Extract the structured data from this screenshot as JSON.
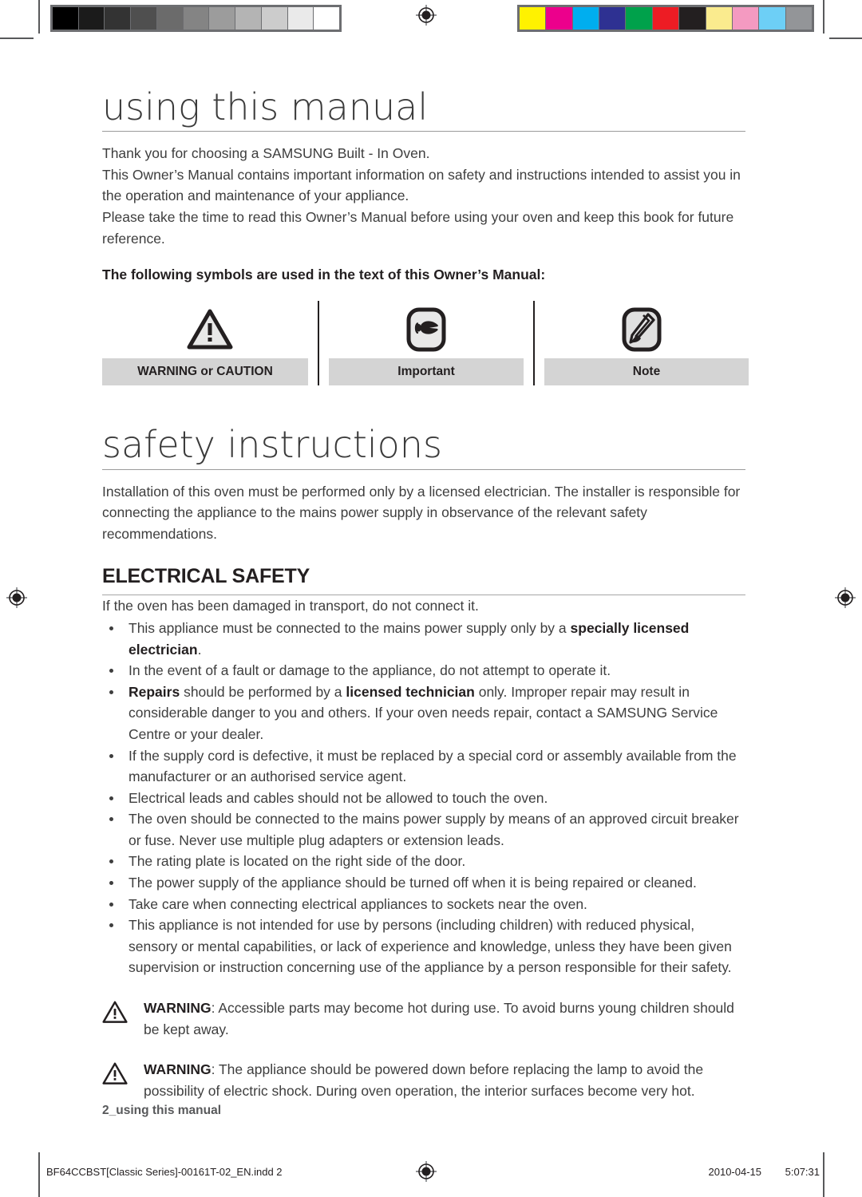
{
  "page": {
    "running_footer": "2_using this manual",
    "print_footer": {
      "file": "BF64CCBST[Classic Series]-00161T-02_EN.indd   2",
      "date": "2010-04-15",
      "time": "5:07:31"
    }
  },
  "calibration": {
    "gray_bar_label": "grayscale-calibration-bar",
    "gray_swatches": [
      "#000000",
      "#1b1b1b",
      "#333333",
      "#4f4f4f",
      "#6b6b6b",
      "#848484",
      "#9c9c9c",
      "#b4b4b4",
      "#cccccc",
      "#eaeaea",
      "#ffffff"
    ],
    "color_bar_label": "color-calibration-bar",
    "color_swatches": [
      "#fff200",
      "#ec008c",
      "#00aeef",
      "#2e3192",
      "#00a14b",
      "#ed1c24",
      "#231f20",
      "#faeb8e",
      "#f49ac1",
      "#6dcff6",
      "#939598"
    ]
  },
  "chapter1": {
    "title": "using this manual",
    "paragraphs": [
      "Thank you for choosing a SAMSUNG Built - In Oven.",
      "This Owner’s Manual contains important information on safety and instructions intended to assist you in the operation and maintenance of your appliance.",
      "Please take the time to read this Owner’s Manual before using your oven and keep this book for future reference."
    ],
    "symbols_lead_in": "The following symbols are used in the text of this Owner’s Manual:",
    "symbols": [
      {
        "icon": "warning-triangle-icon",
        "label": "WARNING or CAUTION"
      },
      {
        "icon": "pointing-hand-icon",
        "label": "Important"
      },
      {
        "icon": "pencil-note-icon",
        "label": "Note"
      }
    ]
  },
  "chapter2": {
    "title": "safety instructions",
    "intro": "Installation of this oven must be performed only by a licensed electrician. The installer is responsible for connecting the appliance to the mains power supply in observance of the relevant safety recommendations.",
    "section": {
      "heading": "ELECTRICAL SAFETY",
      "intro": "If the oven has been damaged in transport, do not connect it.",
      "bullets": [
        [
          {
            "t": "This appliance must be connected to the mains power supply only by a "
          },
          {
            "t": "specially licensed electrician",
            "b": true
          },
          {
            "t": "."
          }
        ],
        [
          {
            "t": "In the event of a fault or damage to the appliance, do not attempt to operate it."
          }
        ],
        [
          {
            "t": "Repairs",
            "b": true
          },
          {
            "t": " should be performed by a "
          },
          {
            "t": "licensed technician",
            "b": true
          },
          {
            "t": " only. Improper repair may result in considerable danger to you and others. If your oven needs repair, contact a SAMSUNG Service Centre or your dealer."
          }
        ],
        [
          {
            "t": "If the supply cord is defective, it must be replaced by a special cord or assembly available from the manufacturer or an authorised service agent."
          }
        ],
        [
          {
            "t": "Electrical leads and cables should not be allowed to touch the oven."
          }
        ],
        [
          {
            "t": "The oven should be connected to the mains power supply by means of an approved circuit breaker or fuse. Never use multiple plug adapters or extension leads."
          }
        ],
        [
          {
            "t": "The rating plate is located on the right side of the door."
          }
        ],
        [
          {
            "t": "The power supply of the appliance should be turned off when it is being repaired or cleaned."
          }
        ],
        [
          {
            "t": "Take care when connecting electrical appliances to sockets near the oven."
          }
        ],
        [
          {
            "t": "This appliance is not intended for use by persons (including children) with reduced physical, sensory or mental capabilities, or lack of experience and knowledge, unless they have been given supervision or instruction concerning use of the appliance by a person responsible for their safety."
          }
        ]
      ],
      "warnings": [
        [
          {
            "t": "WARNING",
            "b": true
          },
          {
            "t": ": Accessible parts may become hot during use. To avoid burns young children should be kept away."
          }
        ],
        [
          {
            "t": "WARNING",
            "b": true
          },
          {
            "t": ": The appliance should be powered down before replacing the lamp to avoid the possibility of electric shock. During oven operation, the interior surfaces become very hot."
          }
        ]
      ]
    }
  }
}
